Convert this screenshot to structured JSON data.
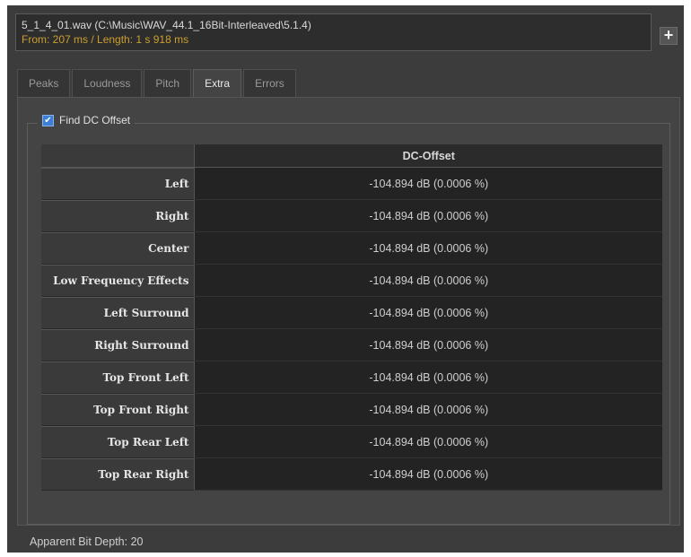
{
  "file": {
    "name": "5_1_4_01.wav (C:\\Music\\WAV_44.1_16Bit-Interleaved\\5.1.4)",
    "range": "From: 207 ms / Length: 1 s 918 ms"
  },
  "add_button_label": "+",
  "tabs": [
    {
      "label": "Peaks"
    },
    {
      "label": "Loudness"
    },
    {
      "label": "Pitch"
    },
    {
      "label": "Extra"
    },
    {
      "label": "Errors"
    }
  ],
  "active_tab": "Extra",
  "dc_group": {
    "checkbox_label": "Find DC Offset",
    "checked": true,
    "check_mark": "✔"
  },
  "table": {
    "column_header": "DC-Offset",
    "rows": [
      {
        "label": "Left",
        "value": "-104.894 dB (0.0006 %)"
      },
      {
        "label": "Right",
        "value": "-104.894 dB (0.0006 %)"
      },
      {
        "label": "Center",
        "value": "-104.894 dB (0.0006 %)"
      },
      {
        "label": "Low Frequency Effects",
        "value": "-104.894 dB (0.0006 %)"
      },
      {
        "label": "Left Surround",
        "value": "-104.894 dB (0.0006 %)"
      },
      {
        "label": "Right Surround",
        "value": "-104.894 dB (0.0006 %)"
      },
      {
        "label": "Top Front Left",
        "value": "-104.894 dB (0.0006 %)"
      },
      {
        "label": "Top Front Right",
        "value": "-104.894 dB (0.0006 %)"
      },
      {
        "label": "Top Rear Left",
        "value": "-104.894 dB (0.0006 %)"
      },
      {
        "label": "Top Rear Right",
        "value": "-104.894 dB (0.0006 %)"
      }
    ]
  },
  "footer": {
    "bit_depth": "Apparent Bit Depth: 20"
  }
}
